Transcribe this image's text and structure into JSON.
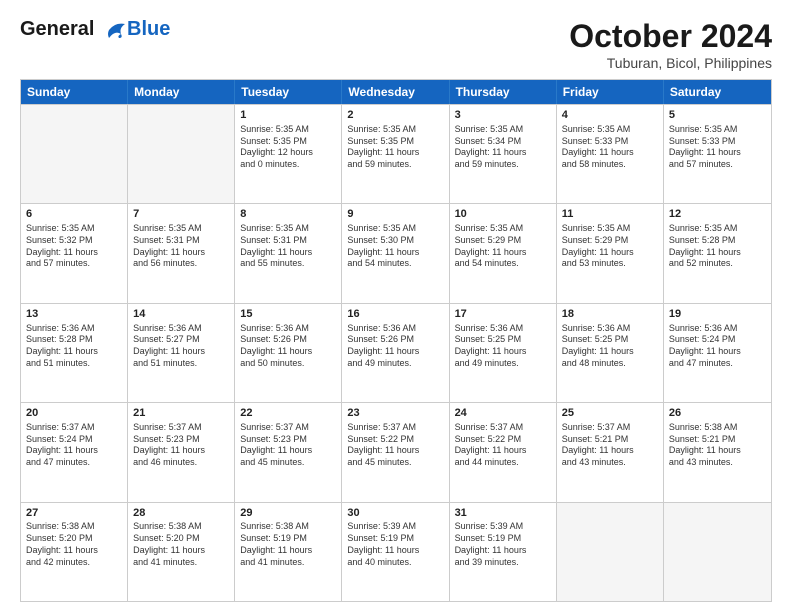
{
  "header": {
    "logo_line1": "General",
    "logo_line2": "Blue",
    "month": "October 2024",
    "location": "Tuburan, Bicol, Philippines"
  },
  "weekdays": [
    "Sunday",
    "Monday",
    "Tuesday",
    "Wednesday",
    "Thursday",
    "Friday",
    "Saturday"
  ],
  "weeks": [
    [
      {
        "day": "",
        "info": "",
        "empty": true
      },
      {
        "day": "",
        "info": "",
        "empty": true
      },
      {
        "day": "1",
        "info": "Sunrise: 5:35 AM\nSunset: 5:35 PM\nDaylight: 12 hours\nand 0 minutes.",
        "empty": false
      },
      {
        "day": "2",
        "info": "Sunrise: 5:35 AM\nSunset: 5:35 PM\nDaylight: 11 hours\nand 59 minutes.",
        "empty": false
      },
      {
        "day": "3",
        "info": "Sunrise: 5:35 AM\nSunset: 5:34 PM\nDaylight: 11 hours\nand 59 minutes.",
        "empty": false
      },
      {
        "day": "4",
        "info": "Sunrise: 5:35 AM\nSunset: 5:33 PM\nDaylight: 11 hours\nand 58 minutes.",
        "empty": false
      },
      {
        "day": "5",
        "info": "Sunrise: 5:35 AM\nSunset: 5:33 PM\nDaylight: 11 hours\nand 57 minutes.",
        "empty": false
      }
    ],
    [
      {
        "day": "6",
        "info": "Sunrise: 5:35 AM\nSunset: 5:32 PM\nDaylight: 11 hours\nand 57 minutes.",
        "empty": false
      },
      {
        "day": "7",
        "info": "Sunrise: 5:35 AM\nSunset: 5:31 PM\nDaylight: 11 hours\nand 56 minutes.",
        "empty": false
      },
      {
        "day": "8",
        "info": "Sunrise: 5:35 AM\nSunset: 5:31 PM\nDaylight: 11 hours\nand 55 minutes.",
        "empty": false
      },
      {
        "day": "9",
        "info": "Sunrise: 5:35 AM\nSunset: 5:30 PM\nDaylight: 11 hours\nand 54 minutes.",
        "empty": false
      },
      {
        "day": "10",
        "info": "Sunrise: 5:35 AM\nSunset: 5:29 PM\nDaylight: 11 hours\nand 54 minutes.",
        "empty": false
      },
      {
        "day": "11",
        "info": "Sunrise: 5:35 AM\nSunset: 5:29 PM\nDaylight: 11 hours\nand 53 minutes.",
        "empty": false
      },
      {
        "day": "12",
        "info": "Sunrise: 5:35 AM\nSunset: 5:28 PM\nDaylight: 11 hours\nand 52 minutes.",
        "empty": false
      }
    ],
    [
      {
        "day": "13",
        "info": "Sunrise: 5:36 AM\nSunset: 5:28 PM\nDaylight: 11 hours\nand 51 minutes.",
        "empty": false
      },
      {
        "day": "14",
        "info": "Sunrise: 5:36 AM\nSunset: 5:27 PM\nDaylight: 11 hours\nand 51 minutes.",
        "empty": false
      },
      {
        "day": "15",
        "info": "Sunrise: 5:36 AM\nSunset: 5:26 PM\nDaylight: 11 hours\nand 50 minutes.",
        "empty": false
      },
      {
        "day": "16",
        "info": "Sunrise: 5:36 AM\nSunset: 5:26 PM\nDaylight: 11 hours\nand 49 minutes.",
        "empty": false
      },
      {
        "day": "17",
        "info": "Sunrise: 5:36 AM\nSunset: 5:25 PM\nDaylight: 11 hours\nand 49 minutes.",
        "empty": false
      },
      {
        "day": "18",
        "info": "Sunrise: 5:36 AM\nSunset: 5:25 PM\nDaylight: 11 hours\nand 48 minutes.",
        "empty": false
      },
      {
        "day": "19",
        "info": "Sunrise: 5:36 AM\nSunset: 5:24 PM\nDaylight: 11 hours\nand 47 minutes.",
        "empty": false
      }
    ],
    [
      {
        "day": "20",
        "info": "Sunrise: 5:37 AM\nSunset: 5:24 PM\nDaylight: 11 hours\nand 47 minutes.",
        "empty": false
      },
      {
        "day": "21",
        "info": "Sunrise: 5:37 AM\nSunset: 5:23 PM\nDaylight: 11 hours\nand 46 minutes.",
        "empty": false
      },
      {
        "day": "22",
        "info": "Sunrise: 5:37 AM\nSunset: 5:23 PM\nDaylight: 11 hours\nand 45 minutes.",
        "empty": false
      },
      {
        "day": "23",
        "info": "Sunrise: 5:37 AM\nSunset: 5:22 PM\nDaylight: 11 hours\nand 45 minutes.",
        "empty": false
      },
      {
        "day": "24",
        "info": "Sunrise: 5:37 AM\nSunset: 5:22 PM\nDaylight: 11 hours\nand 44 minutes.",
        "empty": false
      },
      {
        "day": "25",
        "info": "Sunrise: 5:37 AM\nSunset: 5:21 PM\nDaylight: 11 hours\nand 43 minutes.",
        "empty": false
      },
      {
        "day": "26",
        "info": "Sunrise: 5:38 AM\nSunset: 5:21 PM\nDaylight: 11 hours\nand 43 minutes.",
        "empty": false
      }
    ],
    [
      {
        "day": "27",
        "info": "Sunrise: 5:38 AM\nSunset: 5:20 PM\nDaylight: 11 hours\nand 42 minutes.",
        "empty": false
      },
      {
        "day": "28",
        "info": "Sunrise: 5:38 AM\nSunset: 5:20 PM\nDaylight: 11 hours\nand 41 minutes.",
        "empty": false
      },
      {
        "day": "29",
        "info": "Sunrise: 5:38 AM\nSunset: 5:19 PM\nDaylight: 11 hours\nand 41 minutes.",
        "empty": false
      },
      {
        "day": "30",
        "info": "Sunrise: 5:39 AM\nSunset: 5:19 PM\nDaylight: 11 hours\nand 40 minutes.",
        "empty": false
      },
      {
        "day": "31",
        "info": "Sunrise: 5:39 AM\nSunset: 5:19 PM\nDaylight: 11 hours\nand 39 minutes.",
        "empty": false
      },
      {
        "day": "",
        "info": "",
        "empty": true
      },
      {
        "day": "",
        "info": "",
        "empty": true
      }
    ]
  ]
}
